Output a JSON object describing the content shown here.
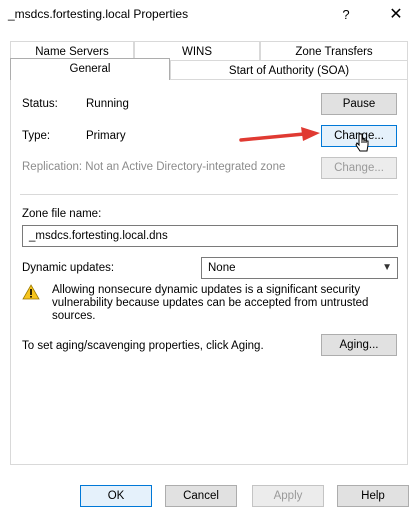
{
  "window": {
    "title": "_msdcs.fortesting.local Properties",
    "help": "?",
    "close": "✕"
  },
  "tabs_row1": [
    "Name Servers",
    "WINS",
    "Zone Transfers"
  ],
  "tabs_row2": [
    "General",
    "Start of Authority (SOA)"
  ],
  "general": {
    "status_label": "Status:",
    "status_value": "Running",
    "pause_label": "Pause",
    "type_label": "Type:",
    "type_value": "Primary",
    "change_type_label": "Change...",
    "replication_text": "Replication: Not an Active Directory-integrated zone",
    "change_replication_label": "Change...",
    "zone_file_label": "Zone file name:",
    "zone_file_value": "_msdcs.fortesting.local.dns",
    "dynamic_label": "Dynamic updates:",
    "dynamic_value": "None",
    "warning_text": "Allowing nonsecure dynamic updates is a significant security vulnerability because updates can be accepted from untrusted sources.",
    "aging_text": "To set aging/scavenging properties, click Aging.",
    "aging_label": "Aging..."
  },
  "footer": {
    "ok": "OK",
    "cancel": "Cancel",
    "apply": "Apply",
    "help": "Help"
  },
  "colors": {
    "arrow": "#e03a32",
    "focus_border": "#0078d7"
  }
}
